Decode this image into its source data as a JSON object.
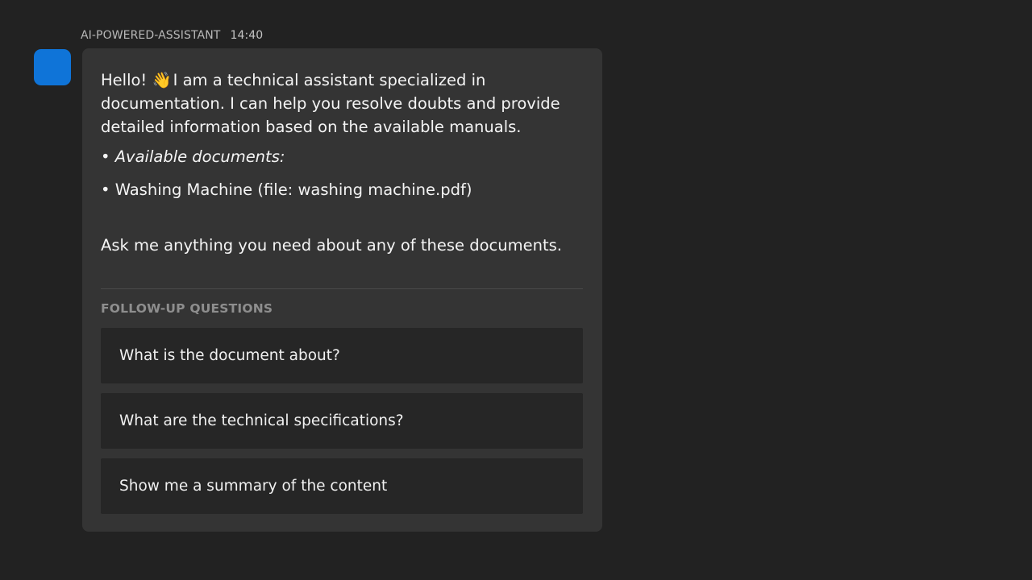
{
  "message": {
    "sender": "AI-POWERED-ASSISTANT",
    "timestamp": "14:40",
    "avatar_color": "#0f74d8",
    "greeting": "Hello!",
    "wave_emoji": "👋",
    "intro": "I am a technical assistant specialized in documentation. I can help you resolve doubts and provide detailed information based on the available manuals.",
    "documents_heading": "• Available documents:",
    "documents": [
      "• Washing Machine (file: washing machine.pdf)"
    ],
    "closing": "Ask me anything you need about any of these documents."
  },
  "followups": {
    "header": "FOLLOW-UP QUESTIONS",
    "questions": [
      "What is the document about?",
      "What are the technical specifications?",
      "Show me a summary of the content"
    ]
  }
}
